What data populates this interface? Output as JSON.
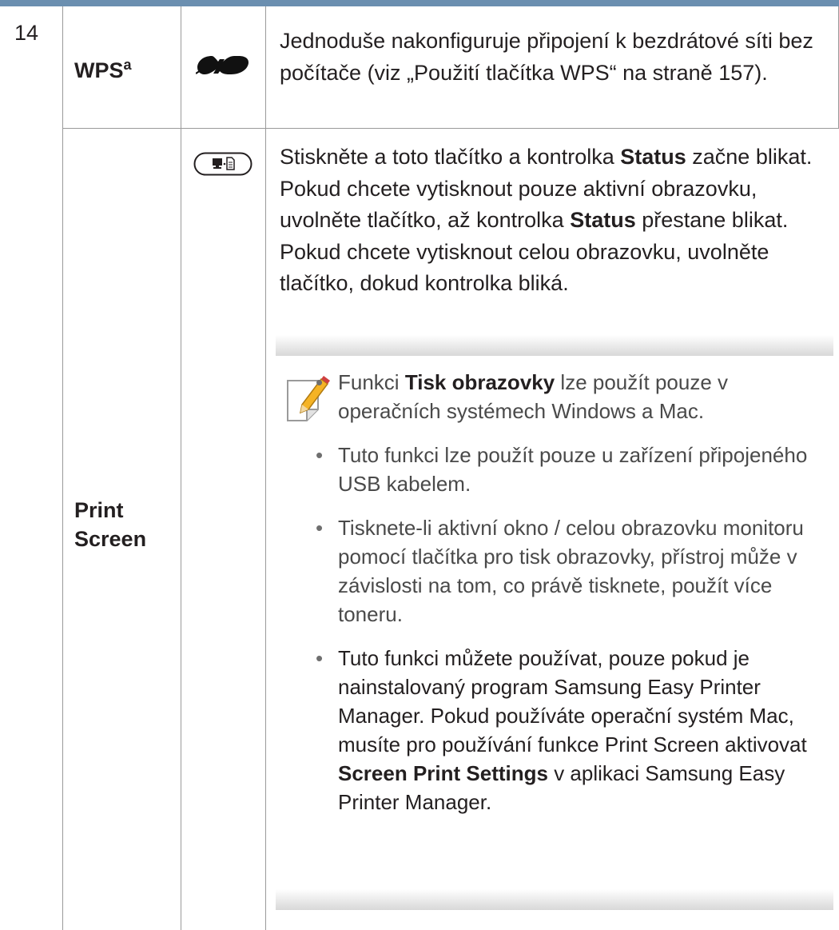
{
  "colors": {
    "header_rule": "#6b8fb0",
    "grid_line": "#9a9a9a",
    "text": "#231f20"
  },
  "row_number": "14",
  "wps": {
    "label": "WPS",
    "footnote_mark": "a",
    "icon": "wps-icon",
    "description": "Jednoduše nakonfiguruje připojení k bezdrátové síti bez počítače (viz „Použití tlačítka WPS“ na straně 157)."
  },
  "print_screen": {
    "label_line1": "Print",
    "label_line2": "Screen",
    "icon": "print-screen-icon",
    "desc": {
      "p1": "Stiskněte a toto tlačítko a kontrolka ",
      "status1": "Status",
      "p2": " začne blikat. Pokud chcete vytisknout pouze aktivní obrazovku, uvolněte tlačítko, až kontrolka ",
      "status2": "Status",
      "p3": " přestane blikat. Pokud chcete vytisknout celou obrazovku, uvolněte tlačítko, dokud kontrolka bliká."
    },
    "note": {
      "icon": "note-pencil-icon",
      "bullet": "•",
      "item1_pre": "Funkci ",
      "item1_bold": "Tisk obrazovky",
      "item1_post": " lze použít pouze v operačních systémech Windows a Mac.",
      "item2": "Tuto funkci lze použít pouze u zařízení připojeného USB kabelem.",
      "item3": "Tisknete-li aktivní okno / celou obrazovku monitoru pomocí tlačítka pro tisk obrazovky, přístroj může v závislosti na tom, co právě tisknete, použít více toneru.",
      "item4_pre": "Tuto funkci můžete používat, pouze pokud je nainstalovaný program Samsung Easy Printer Manager. Pokud používáte operační systém Mac, musíte pro používání funkce Print Screen aktivovat ",
      "item4_bold": "Screen Print Settings",
      "item4_post": " v aplikaci Samsung Easy Printer Manager."
    }
  }
}
